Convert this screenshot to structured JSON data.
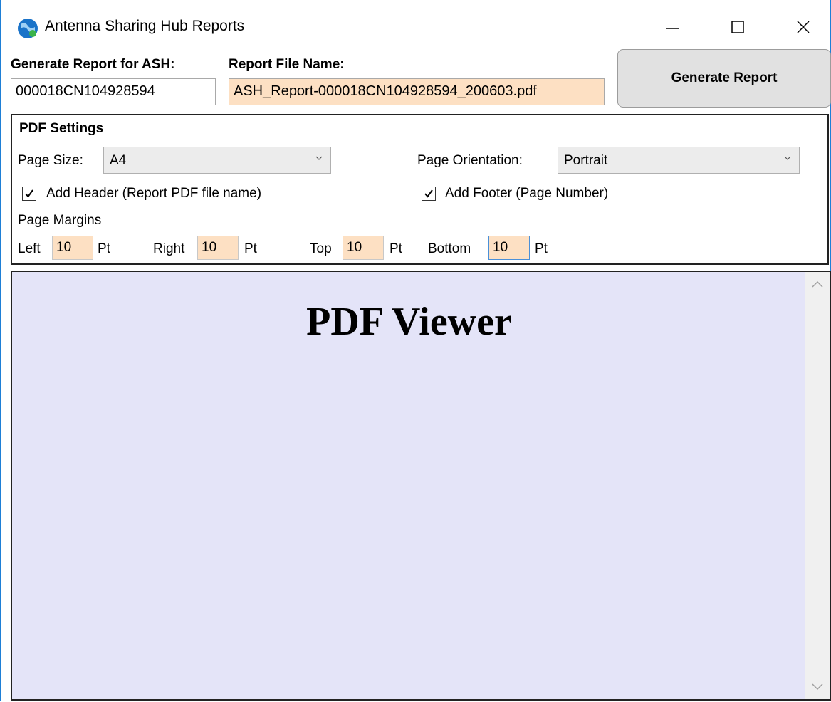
{
  "window": {
    "title": "Antenna Sharing Hub Reports",
    "icon": "globe-icon"
  },
  "report": {
    "ash_label": "Generate Report for ASH:",
    "ash_value": "000018CN104928594",
    "file_name_label": "Report File Name:",
    "file_name_value": "ASH_Report-000018CN104928594_200603.pdf",
    "generate_button": "Generate Report"
  },
  "pdf_settings": {
    "title": "PDF Settings",
    "page_size_label": "Page Size:",
    "page_size_value": "A4",
    "orientation_label": "Page Orientation:",
    "orientation_value": "Portrait",
    "add_header_label": "Add Header (Report PDF file name)",
    "add_header_checked": true,
    "add_footer_label": "Add Footer (Page Number)",
    "add_footer_checked": true,
    "margins_label": "Page Margins",
    "left_label": "Left",
    "left_value": "10",
    "right_label": "Right",
    "right_value": "10",
    "top_label": "Top",
    "top_value": "10",
    "bottom_label": "Bottom",
    "bottom_value": "10",
    "unit": "Pt"
  },
  "viewer": {
    "title": "PDF Viewer"
  },
  "colors": {
    "input_highlight": "#fde0c3",
    "viewer_bg": "#e4e4f8",
    "window_border": "#1e7fd6"
  }
}
